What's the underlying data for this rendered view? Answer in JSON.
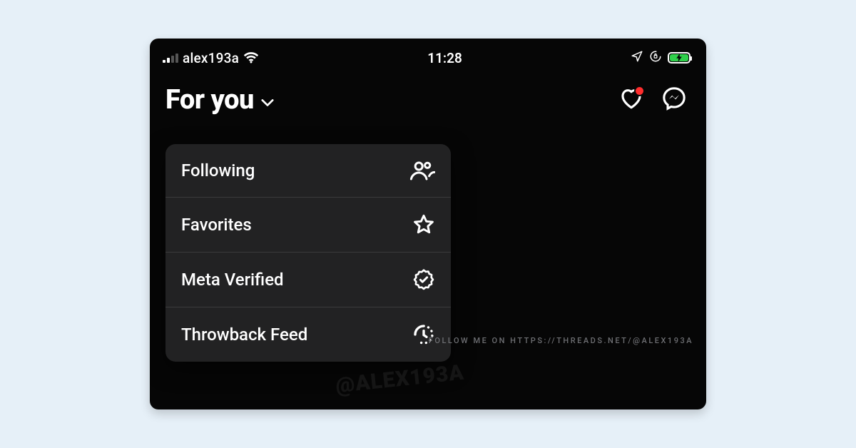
{
  "status_bar": {
    "carrier": "alex193a",
    "time": "11:28"
  },
  "header": {
    "title": "For you"
  },
  "menu": {
    "items": [
      {
        "label": "Following",
        "icon": "people-icon"
      },
      {
        "label": "Favorites",
        "icon": "star-icon"
      },
      {
        "label": "Meta Verified",
        "icon": "verified-badge-icon"
      },
      {
        "label": "Throwback Feed",
        "icon": "clock-icon"
      }
    ]
  },
  "watermark": {
    "handle": "@ALEX193A",
    "follow_text": "FOLLOW ME ON HTTPS://THREADS.NET/@ALEX193A"
  },
  "colors": {
    "page_bg": "#e6f0f8",
    "device_bg": "#060606",
    "menu_bg": "#222223",
    "battery_fill": "#2fd04b",
    "notification_dot": "#ff2d2d"
  }
}
